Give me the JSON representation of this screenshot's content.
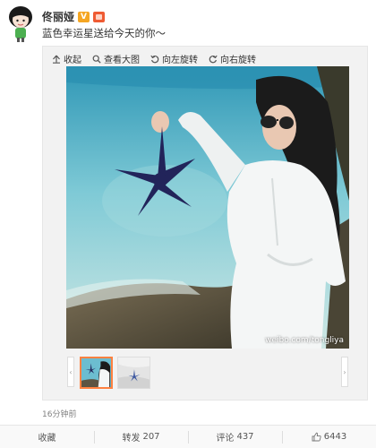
{
  "author": {
    "name": "佟丽娅",
    "vip_badge": "V"
  },
  "post": {
    "text": "蓝色幸运星送给今天的你～",
    "timestamp": "16分钟前"
  },
  "toolbar": {
    "collapse_label": "收起",
    "view_large_label": "查看大图",
    "rotate_left_label": "向左旋转",
    "rotate_right_label": "向右旋转"
  },
  "media": {
    "watermark": "weibo.com/tongliya"
  },
  "thumbnails": [
    {
      "name": "thumb-1",
      "selected": true
    },
    {
      "name": "thumb-2",
      "selected": false
    }
  ],
  "actions": {
    "favorite_label": "收藏",
    "repost_label": "转发",
    "repost_count": "207",
    "comment_label": "评论",
    "comment_count": "437",
    "like_count": "6443"
  },
  "colors": {
    "accent": "#ff8140",
    "badge_gold": "#f5a623",
    "badge_red": "#ef5b33",
    "starfish": "#22245a"
  }
}
